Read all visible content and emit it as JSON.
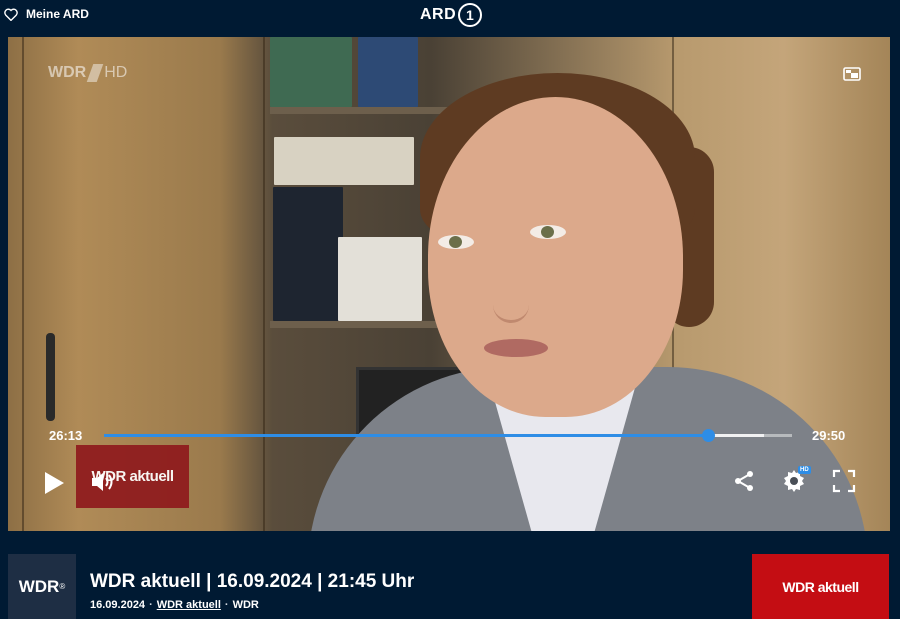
{
  "header": {
    "meine_ard_label": "Meine ARD",
    "logo_text": "ARD",
    "logo_one": "1"
  },
  "player": {
    "watermark_brand": "WDR",
    "watermark_quality": "HD",
    "current_time": "26:13",
    "total_time": "29:50",
    "progress": 0.878,
    "buffered": 0.96,
    "thumbnail_label": "WDR aktuell",
    "settings_badge": "HD",
    "accent_color": "#2e8de6",
    "icons": [
      "picture-in-picture-icon",
      "play-icon",
      "volume-icon",
      "share-icon",
      "settings-gear-icon",
      "fullscreen-icon"
    ]
  },
  "info": {
    "channel_logo": "WDR",
    "channel_logo_mark": "®",
    "title": "WDR aktuell | 16.09.2024 | 21:45 Uhr",
    "date": "16.09.2024",
    "show_link": "WDR aktuell",
    "channel": "WDR",
    "separator": "·",
    "card_label": "WDR aktuell",
    "card_color": "#c40d13"
  }
}
